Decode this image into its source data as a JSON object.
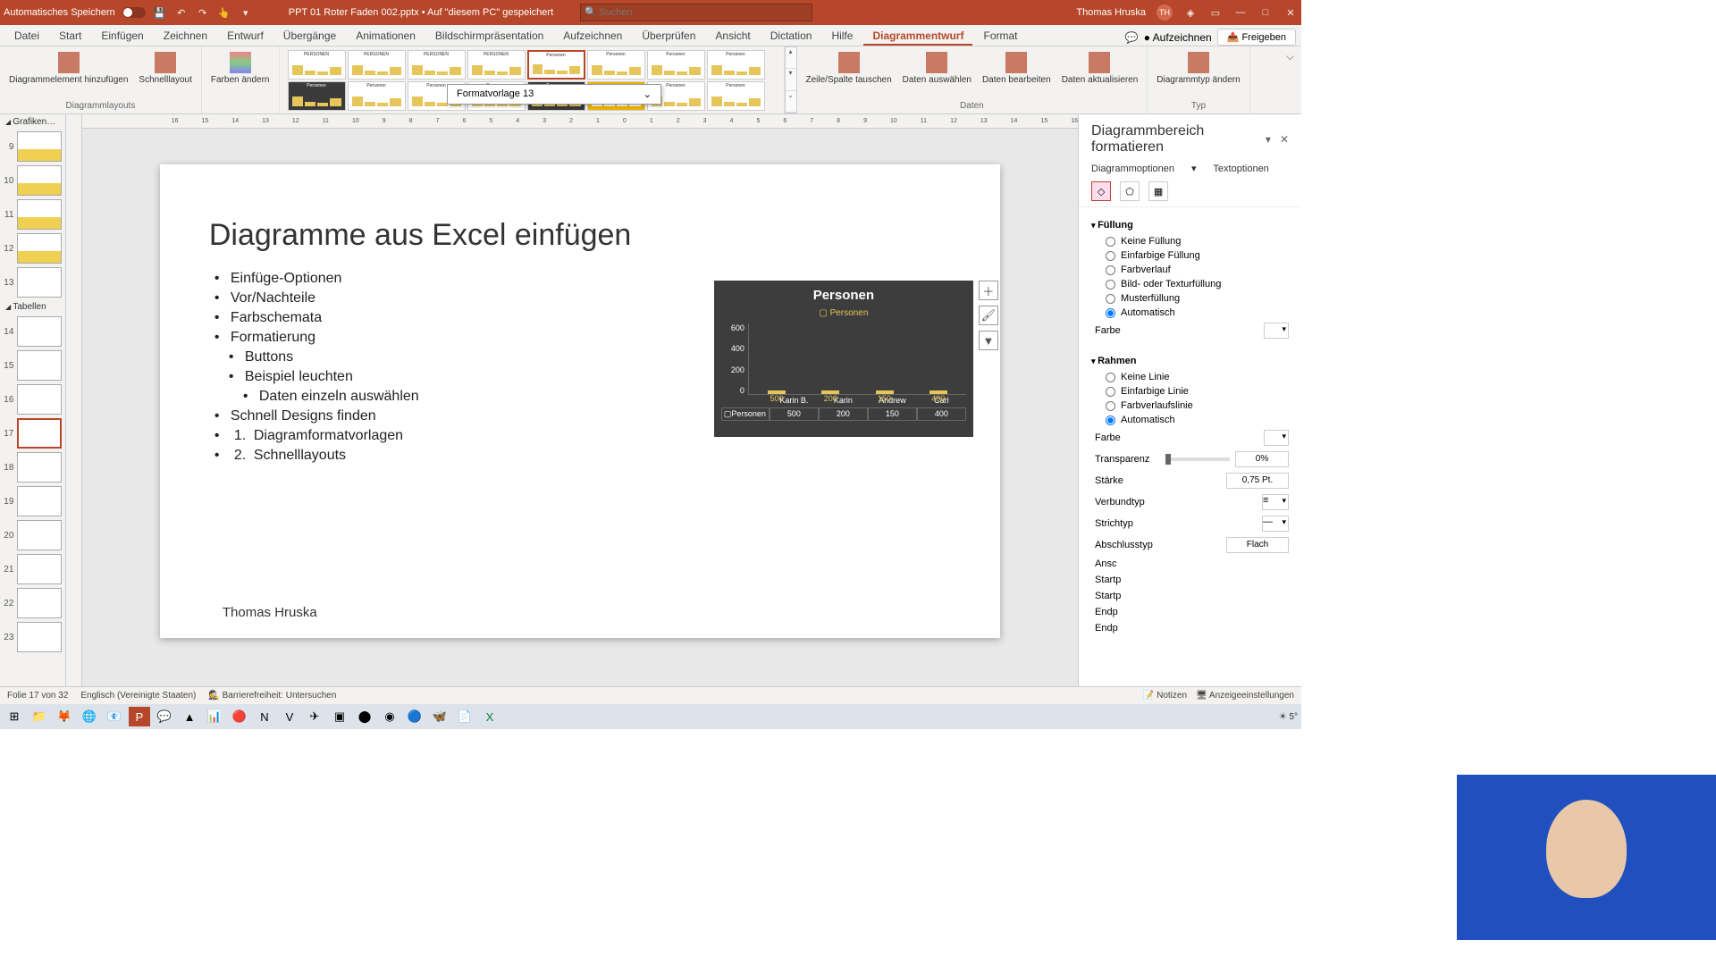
{
  "titlebar": {
    "autosave": "Automatisches Speichern",
    "filename": "PPT 01 Roter Faden 002.pptx • Auf \"diesem PC\" gespeichert",
    "search_placeholder": "Suchen",
    "user": "Thomas Hruska",
    "initials": "TH"
  },
  "tabs": {
    "datei": "Datei",
    "start": "Start",
    "einfuegen": "Einfügen",
    "zeichnen": "Zeichnen",
    "entwurf": "Entwurf",
    "uebergaenge": "Übergänge",
    "animationen": "Animationen",
    "praes": "Bildschirmpräsentation",
    "aufz": "Aufzeichnen",
    "ueberpr": "Überprüfen",
    "ansicht": "Ansicht",
    "dictation": "Dictation",
    "hilfe": "Hilfe",
    "diagrammentwurf": "Diagrammentwurf",
    "format": "Format",
    "aufzeichnen_btn": "Aufzeichnen",
    "freigeben": "Freigeben"
  },
  "ribbon": {
    "add_elem": "Diagrammelement hinzufügen",
    "schnelllayout": "Schnelllayout",
    "layouts_grp": "Diagrammlayouts",
    "farben": "Farben ändern",
    "zeilesp": "Zeile/Spalte tauschen",
    "daten_ausw": "Daten auswählen",
    "daten_bearb": "Daten bearbeiten",
    "daten_akt": "Daten aktualisieren",
    "daten_grp": "Daten",
    "typ_aendern": "Diagrammtyp ändern",
    "typ_grp": "Typ",
    "tooltip": "Formatvorlage 13"
  },
  "slides": {
    "hdr1": "Grafiken…",
    "hdr2": "Tabellen",
    "nums": [
      "9",
      "10",
      "11",
      "12",
      "13",
      "14",
      "15",
      "16",
      "17",
      "18",
      "19",
      "20",
      "21",
      "22",
      "23"
    ]
  },
  "slide": {
    "title": "Diagramme aus Excel einfügen",
    "b1": "Einfüge-Optionen",
    "b2": "Vor/Nachteile",
    "b3": "Farbschemata",
    "b4": "Formatierung",
    "b4a": "Buttons",
    "b4b": "Beispiel leuchten",
    "b4b1": "Daten einzeln auswählen",
    "b5": "Schnell Designs finden",
    "b5a": "Diagramformatvorlagen",
    "b5b": "Schnelllayouts",
    "footer": "Thomas Hruska"
  },
  "chart_data": {
    "type": "bar",
    "title": "Personen",
    "legend": "Personen",
    "categories": [
      "Karin B.",
      "Karin",
      "Andrew",
      "Carl"
    ],
    "values": [
      500,
      200,
      150,
      400
    ],
    "ylim": [
      0,
      600
    ],
    "yticks": [
      "600",
      "400",
      "200",
      "0"
    ],
    "row_label": "Personen"
  },
  "pane": {
    "title": "Diagrammbereich formatieren",
    "tab1": "Diagrammoptionen",
    "tab2": "Textoptionen",
    "fuellung": "Füllung",
    "f_keine": "Keine Füllung",
    "f_einf": "Einfarbige Füllung",
    "f_verlauf": "Farbverlauf",
    "f_bild": "Bild- oder Texturfüllung",
    "f_muster": "Musterfüllung",
    "f_auto": "Automatisch",
    "farbe": "Farbe",
    "rahmen": "Rahmen",
    "r_keine": "Keine Linie",
    "r_einf": "Einfarbige Linie",
    "r_verlauf": "Farbverlaufslinie",
    "r_auto": "Automatisch",
    "transp": "Transparenz",
    "transp_v": "0%",
    "staerke": "Stärke",
    "staerke_v": "0,75 Pt.",
    "verbund": "Verbundtyp",
    "strich": "Strichtyp",
    "abschluss": "Abschlusstyp",
    "abschluss_v": "Flach",
    "ansch": "Ansc",
    "startp": "Startp",
    "startp2": "Startp",
    "endp": "Endp",
    "endp2": "Endp"
  },
  "status": {
    "folie": "Folie 17 von 32",
    "lang": "Englisch (Vereinigte Staaten)",
    "barrier": "Barrierefreiheit: Untersuchen",
    "notizen": "Notizen",
    "anzeige": "Anzeigeeinstellungen"
  },
  "taskbar": {
    "temp": "5°"
  }
}
